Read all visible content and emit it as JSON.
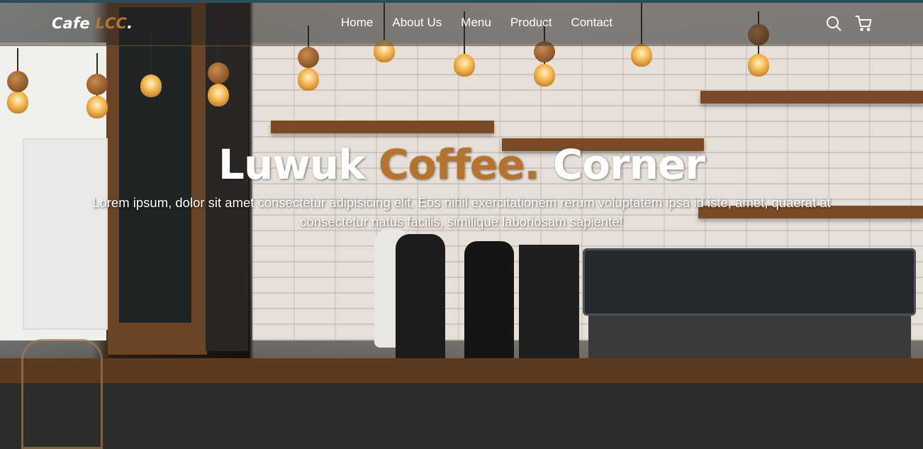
{
  "navbar": {
    "logo": {
      "text": "Cafe",
      "accent": "LCC",
      "dot": "."
    },
    "links": [
      {
        "label": "Home"
      },
      {
        "label": "About Us"
      },
      {
        "label": "Menu"
      },
      {
        "label": "Product"
      },
      {
        "label": "Contact"
      }
    ],
    "icons": [
      "search-icon",
      "cart-icon"
    ]
  },
  "hero": {
    "title_part1": "Luwuk",
    "title_accent": "Coffee.",
    "title_part2": "Corner",
    "description": "Lorem ipsum, dolor sit amet consectetur adipisicing elit. Eos nihil exercitationem rerum voluptatem ipsa id iste, amet, quaerat at consectetur natus facilis, similique laboriosam sapiente!"
  },
  "colors": {
    "accent": "#b6732f",
    "text": "#ffffff",
    "top_border": "#2b4d5c"
  }
}
